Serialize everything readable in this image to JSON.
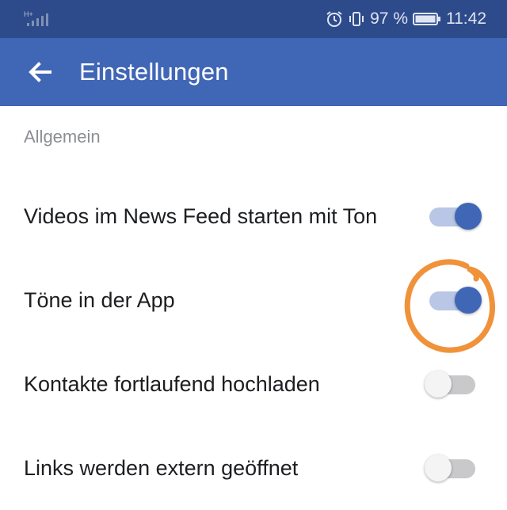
{
  "status_bar": {
    "network_label": "H+",
    "battery_percent": "97 %",
    "time": "11:42",
    "icons": [
      "signal-icon",
      "alarm-icon",
      "vibrate-icon",
      "battery-icon"
    ]
  },
  "app_bar": {
    "title": "Einstellungen",
    "back_icon": "arrow-left-icon"
  },
  "section": {
    "header": "Allgemein"
  },
  "settings": [
    {
      "label": "Videos im News Feed starten mit Ton",
      "enabled": true
    },
    {
      "label": "Töne in der App",
      "enabled": true
    },
    {
      "label": "Kontakte fortlaufend hochladen",
      "enabled": false
    },
    {
      "label": "Links werden extern geöffnet",
      "enabled": false
    }
  ],
  "colors": {
    "status_bar": "#2d4a8a",
    "app_bar": "#4066b6",
    "toggle_on_thumb": "#4066b6",
    "toggle_on_track": "#b9c6e5",
    "toggle_off_thumb": "#f4f4f4",
    "toggle_off_track": "#c9c9cb",
    "annotation": "#f0923a"
  }
}
